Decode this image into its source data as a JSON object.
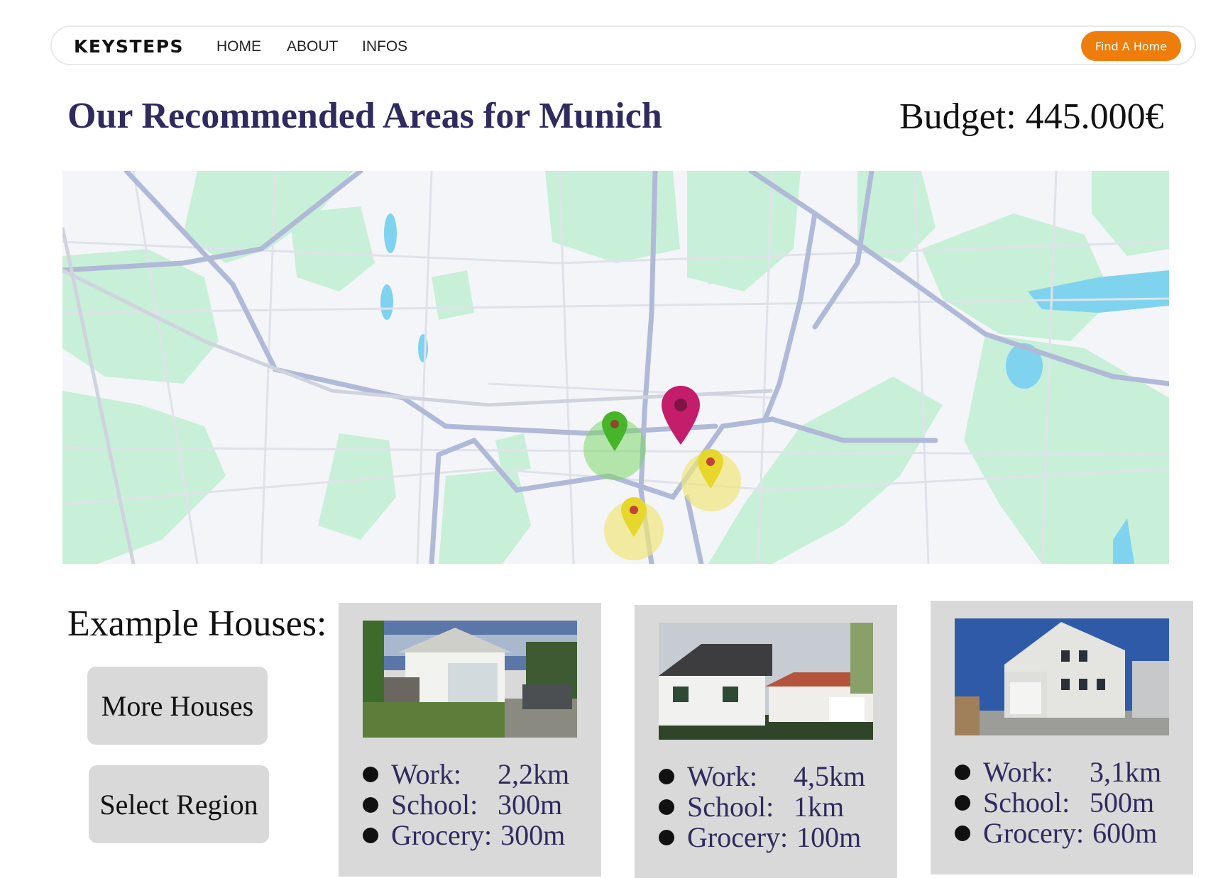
{
  "nav": {
    "logo": "KEYSTEPS",
    "links": [
      "HOME",
      "ABOUT",
      "INFOS"
    ],
    "cta": "Find A Home"
  },
  "page": {
    "title": "Our Recommended Areas for Munich",
    "budget": "Budget: 445.000€"
  },
  "map": {
    "markers": [
      {
        "name": "green-area-marker",
        "color": "#47b52a"
      },
      {
        "name": "magenta-area-marker",
        "color": "#c41d6c"
      },
      {
        "name": "yellow-area-marker-1",
        "color": "#e7d72c"
      },
      {
        "name": "yellow-area-marker-2",
        "color": "#e7d72c"
      }
    ]
  },
  "examples": {
    "title": "Example Houses:",
    "more_button": "More Houses",
    "region_button": "Select Region"
  },
  "houses": [
    {
      "stats": [
        {
          "label": "Work:",
          "value": "2,2km"
        },
        {
          "label": "School:",
          "value": "300m"
        },
        {
          "label": "Grocery:",
          "value": "300m"
        }
      ]
    },
    {
      "stats": [
        {
          "label": "Work:",
          "value": "4,5km"
        },
        {
          "label": "School:",
          "value": "1km"
        },
        {
          "label": "Grocery:",
          "value": "100m"
        }
      ]
    },
    {
      "stats": [
        {
          "label": "Work:",
          "value": "3,1km"
        },
        {
          "label": "School:",
          "value": "500m"
        },
        {
          "label": "Grocery:",
          "value": "600m"
        }
      ]
    }
  ],
  "colors": {
    "accent": "#ee7d0b",
    "heading": "#2f2b5e",
    "card_bg": "#d9d9d9"
  }
}
